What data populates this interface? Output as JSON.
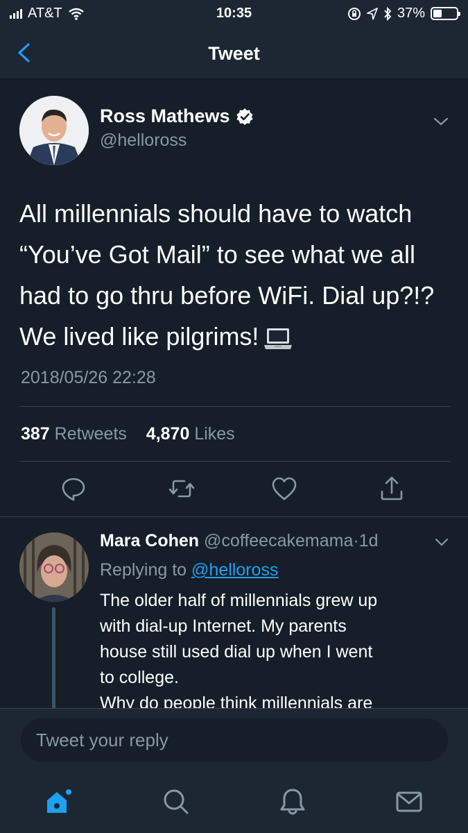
{
  "status_bar": {
    "carrier": "AT&T",
    "time": "10:35",
    "battery": "37%",
    "battery_level": 0.37,
    "icons": [
      "signal-icon",
      "wifi-icon",
      "orientation-lock-icon",
      "location-icon",
      "bluetooth-icon",
      "battery-icon"
    ]
  },
  "nav": {
    "title": "Tweet",
    "back_icon": "chevron-left-icon"
  },
  "tweet": {
    "author_name": "Ross Mathews",
    "author_handle": "@helloross",
    "verified": true,
    "text": "All millennials should have to watch “You’ve Got Mail” to see what we all had to go thru before WiFi. Dial up?!? We lived like pilgrims!",
    "emoji": "laptop-icon",
    "timestamp": "2018/05/26 22:28",
    "retweets_count": "387",
    "retweets_label": "Retweets",
    "likes_count": "4,870",
    "likes_label": "Likes",
    "actions": [
      "reply-icon",
      "retweet-icon",
      "like-icon",
      "share-icon"
    ]
  },
  "reply": {
    "author_name": "Mara Cohen",
    "author_handle": "@coffeecakemama",
    "separator": "·",
    "age": "1d",
    "replying_prefix": "Replying to",
    "replying_to": "@helloross",
    "text_lines": [
      "The older half of millennials grew up",
      "with dial-up Internet.  My parents",
      "house still used dial up when I went",
      "to college.",
      "Why do people think millennials are"
    ]
  },
  "compose": {
    "placeholder": "Tweet your reply"
  },
  "tabs": [
    "home-icon",
    "search-icon",
    "notifications-icon",
    "messages-icon"
  ],
  "colors": {
    "background": "#151e29",
    "bar": "#1c2733",
    "accent": "#1da1f2",
    "muted": "#8899a6",
    "divider": "#38444d"
  }
}
